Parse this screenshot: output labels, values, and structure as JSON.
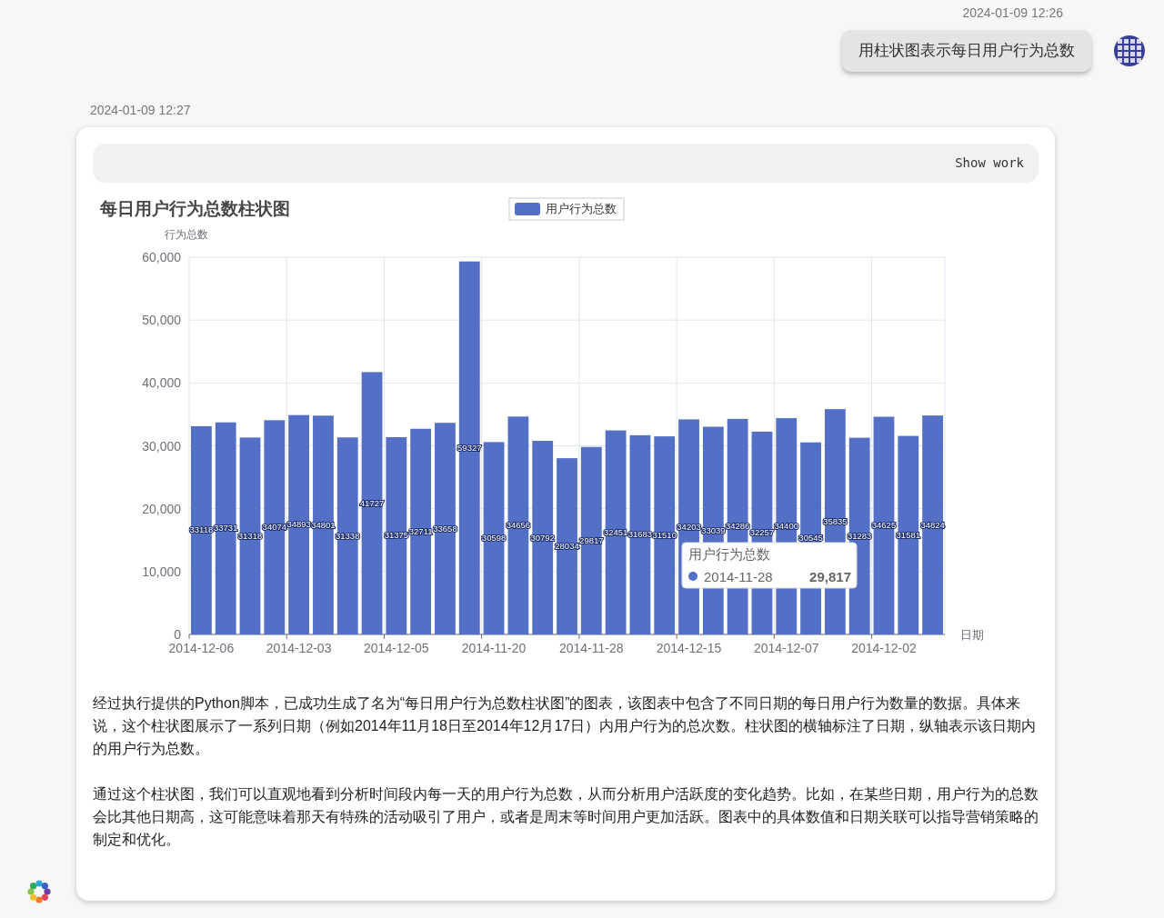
{
  "messages": [
    {
      "kind": "user",
      "time": "2024-01-09 12:26",
      "text": "用柱状图表示每日用户行为总数"
    },
    {
      "kind": "assistant",
      "time": "2024-01-09 12:27",
      "show_work": "Show work",
      "chart": {
        "chart_data": {
          "type": "bar",
          "title": "每日用户行为总数柱状图",
          "xlabel": "日期",
          "ylabel": "行为总数",
          "categories": [
            "2014-12-06",
            null,
            null,
            null,
            "2014-12-03",
            null,
            null,
            null,
            "2014-12-05",
            null,
            null,
            null,
            "2014-11-20",
            null,
            null,
            null,
            "2014-11-28",
            null,
            null,
            null,
            "2014-12-15",
            null,
            null,
            null,
            "2014-12-07",
            null,
            null,
            null,
            "2014-12-02",
            null,
            null
          ],
          "series": [
            {
              "name": "用户行为总数",
              "color": "#5470c6",
              "values": [
                33118,
                33731,
                31318,
                34074,
                34893,
                34801,
                31338,
                41727,
                31375,
                32711,
                33658,
                59327,
                30598,
                34656,
                30792,
                28034,
                29817,
                32451,
                31683,
                31510,
                34203,
                33039,
                34286,
                32257,
                34400,
                30545,
                35835,
                31283,
                34625,
                31581,
                34824
              ]
            }
          ],
          "ylim": [
            0,
            60000
          ],
          "yticks": [
            {
              "value": 0,
              "label": "0"
            },
            {
              "value": 10000,
              "label": "10,000"
            },
            {
              "value": 20000,
              "label": "20,000"
            },
            {
              "value": 30000,
              "label": "30,000"
            },
            {
              "value": 40000,
              "label": "40,000"
            },
            {
              "value": 50000,
              "label": "50,000"
            },
            {
              "value": 60000,
              "label": "60,000"
            }
          ],
          "data_labels": true,
          "grid": true
        },
        "tooltip": {
          "title": "用户行为总数",
          "date": "2014-11-28",
          "value": "29,817"
        }
      },
      "paragraphs": [
        "经过执行提供的Python脚本，已成功生成了名为“每日用户行为总数柱状图”的图表，该图表中包含了不同日期的每日用户行为数量的数据。具体来说，这个柱状图展示了一系列日期（例如2014年11月18日至2014年12月17日）内用户行为的总次数。柱状图的横轴标注了日期，纵轴表示该日期内的用户行为总数。",
        "通过这个柱状图，我们可以直观地看到分析时间段内每一天的用户行为总数，从而分析用户活跃度的变化趋势。比如，在某些日期，用户行为的总数会比其他日期高，这可能意味着那天有特殊的活动吸引了用户，或者是周末等时间用户更加活跃。图表中的具体数值和日期关联可以指导营销策略的制定和优化。"
      ]
    }
  ]
}
